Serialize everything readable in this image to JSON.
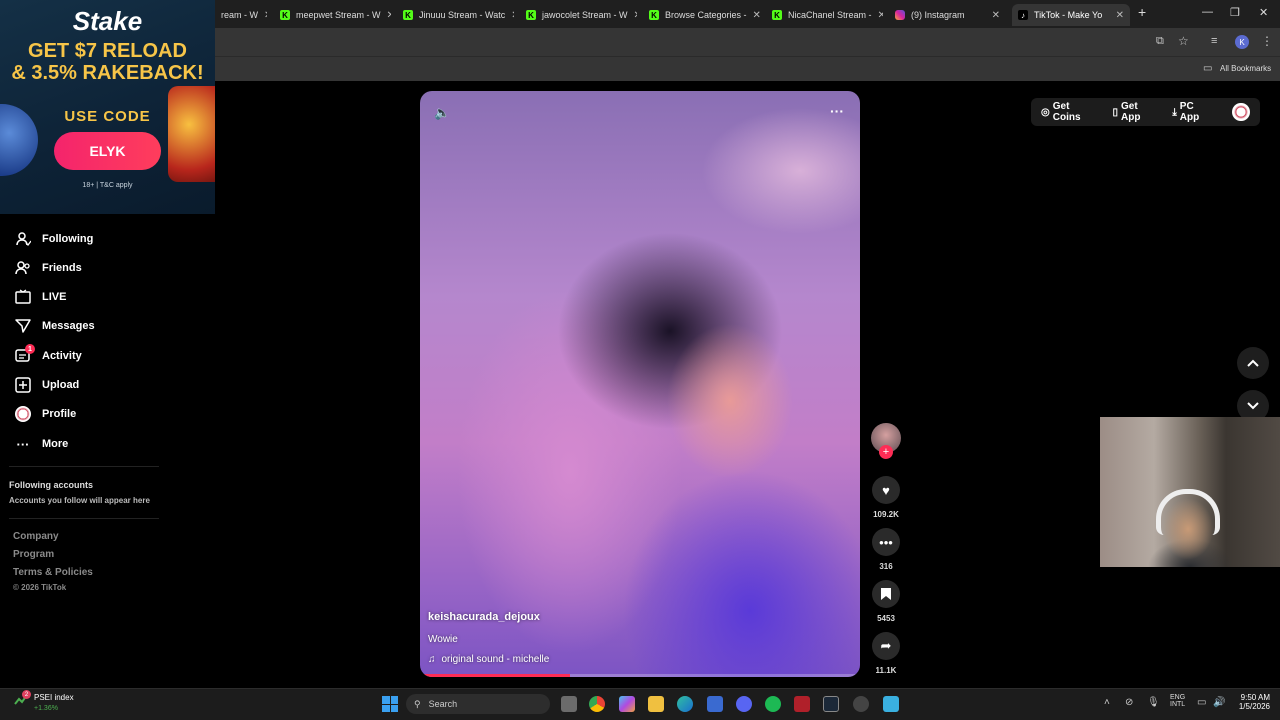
{
  "browser": {
    "tabs": [
      {
        "title": "ream - W",
        "type": "kick"
      },
      {
        "title": "meepwet Stream - W",
        "type": "kick"
      },
      {
        "title": "Jinuuu Stream - Watc",
        "type": "kick"
      },
      {
        "title": "jawocolet Stream - W",
        "type": "kick"
      },
      {
        "title": "Browse Categories -",
        "type": "kick"
      },
      {
        "title": "NicaChanel Stream -",
        "type": "kick"
      },
      {
        "title": "(9) Instagram",
        "type": "instagram"
      },
      {
        "title": "TikTok - Make Yo",
        "type": "tiktok",
        "active": true
      }
    ],
    "bookmarks_label": "All Bookmarks",
    "profile_initial": "K"
  },
  "ad": {
    "brand": "Stake",
    "headline_1": "GET $7 RELOAD",
    "headline_2": "& 3.5% RAKEBACK!",
    "use_code": "USE CODE",
    "code": "ELYK",
    "terms": "18+ | T&C apply"
  },
  "sidebar": {
    "items": [
      {
        "label": "Following",
        "icon": "following-icon"
      },
      {
        "label": "Friends",
        "icon": "friends-icon"
      },
      {
        "label": "LIVE",
        "icon": "live-icon"
      },
      {
        "label": "Messages",
        "icon": "messages-icon"
      },
      {
        "label": "Activity",
        "icon": "activity-icon",
        "badge": "1"
      },
      {
        "label": "Upload",
        "icon": "upload-icon"
      },
      {
        "label": "Profile",
        "icon": "avatar"
      },
      {
        "label": "More",
        "icon": "more-icon"
      }
    ],
    "following_accounts_title": "Following accounts",
    "following_accounts_note": "Accounts you follow will appear here",
    "footer_links": [
      "Company",
      "Program",
      "Terms & Policies"
    ],
    "copyright": "© 2026 TikTok"
  },
  "topbar": {
    "get_coins": "Get Coins",
    "get_app": "Get App",
    "pc_app": "PC App"
  },
  "video": {
    "username": "keishacurada_dejoux",
    "caption": "Wowie",
    "sound": "original sound - michelle",
    "progress": 0.34
  },
  "actions": {
    "likes": "109.2K",
    "comments": "316",
    "saves": "5453",
    "shares": "11.1K"
  },
  "taskbar": {
    "widget_title": "PSEI index",
    "widget_value": "+1.36%",
    "widget_badge": "2",
    "search_placeholder": "Search",
    "lang_1": "ENG",
    "lang_2": "INTL",
    "time": "9:50 AM",
    "date": "1/5/2026"
  },
  "colors": {
    "accent": "#fe2c55",
    "kick": "#53fc18",
    "stake_gold": "#f7c548"
  }
}
